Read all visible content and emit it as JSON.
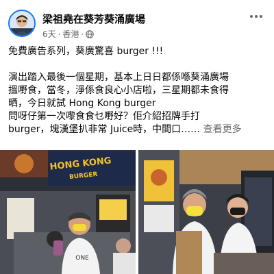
{
  "post": {
    "author": "梁祖堯在葵芳葵涌廣場",
    "time": "6天",
    "separator": "·",
    "location": "香港",
    "separator2": "·",
    "privacy_icon": "globe-icon",
    "more_icon": "more-horizontal-icon",
    "text_lines": [
      "免費廣告系列，葵廣驚喜 burger !!!",
      "",
      "演出踏入最後一個星期，基本上日日都係喺葵涌廣場",
      "搵嘢食，當冬，淨係食良心小店啦，三星期都未食得",
      "晒，今日就試 Hong Kong burger",
      "問呀仔第一次嚟食食乜嘢好？佢介紹招牌手打"
    ],
    "last_line": "burger，塊漢堡扒非常 Juice時，中間口……",
    "see_more": "查看更多"
  },
  "photos": {
    "left_sign": "HONG KONG",
    "left_sign_sub": "BURGER",
    "left_shirt": "ONE"
  },
  "colors": {
    "accent": "#1877f2",
    "secondary_text": "#65676b",
    "primary_text": "#050505"
  }
}
